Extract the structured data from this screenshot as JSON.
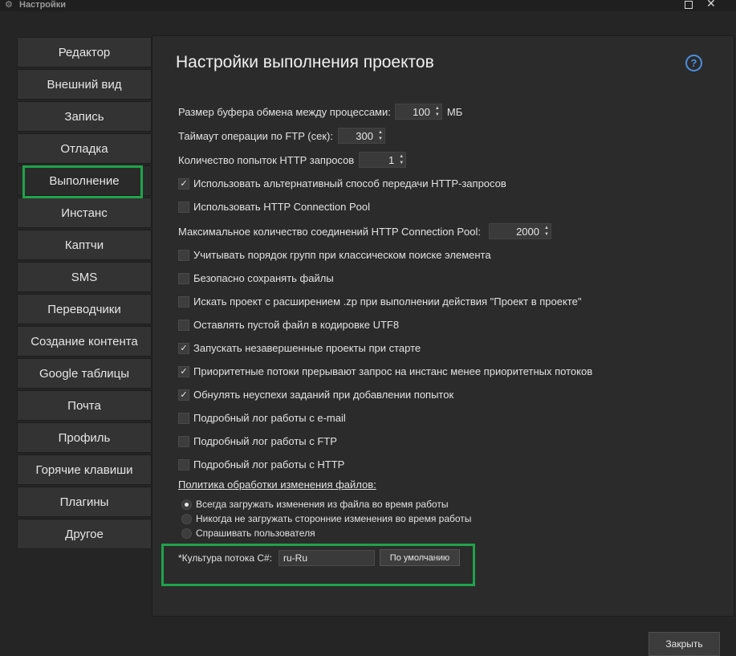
{
  "window": {
    "title": "Настройки",
    "icon": "gear-icon"
  },
  "sidebar": {
    "items": [
      {
        "label": "Редактор"
      },
      {
        "label": "Внешний вид"
      },
      {
        "label": "Запись"
      },
      {
        "label": "Отладка"
      },
      {
        "label": "Выполнение",
        "active": true
      },
      {
        "label": "Инстанс"
      },
      {
        "label": "Каптчи"
      },
      {
        "label": "SMS"
      },
      {
        "label": "Переводчики"
      },
      {
        "label": "Создание контента"
      },
      {
        "label": "Google таблицы"
      },
      {
        "label": "Почта"
      },
      {
        "label": "Профиль"
      },
      {
        "label": "Горячие клавиши"
      },
      {
        "label": "Плагины"
      },
      {
        "label": "Другое"
      }
    ]
  },
  "main": {
    "title": "Настройки выполнения проектов",
    "help_icon": "question-icon",
    "buffer": {
      "label": "Размер буфера обмена между процессами:",
      "value": "100",
      "unit": "МБ"
    },
    "ftp_timeout": {
      "label": "Таймаут операции по FTP (сек):",
      "value": "300"
    },
    "http_retries": {
      "label": "Количество попыток HTTP запросов",
      "value": "1"
    },
    "checkboxes_top": [
      {
        "label": "Использовать альтернативный способ передачи HTTP-запросов",
        "checked": true
      },
      {
        "label": "Использовать HTTP Connection Pool",
        "checked": false
      }
    ],
    "max_connections": {
      "label": "Максимальное количество соединений HTTP Connection Pool:",
      "value": "2000"
    },
    "checkboxes": [
      {
        "label": "Учитывать порядок групп при классическом поиске элемента",
        "checked": false
      },
      {
        "label": "Безопасно сохранять файлы",
        "checked": false
      },
      {
        "label": "Искать проект с расширением .zp при выполнении действия \"Проект в проекте\"",
        "checked": false
      },
      {
        "label": "Оставлять пустой файл в кодировке UTF8",
        "checked": false
      },
      {
        "label": "Запускать незавершенные проекты при старте",
        "checked": true
      },
      {
        "label": "Приоритетные потоки прерывают запрос на инстанс менее приоритетных потоков",
        "checked": true
      },
      {
        "label": "Обнулять неуспехи заданий при добавлении попыток",
        "checked": true
      },
      {
        "label": "Подробный лог работы с e-mail",
        "checked": false
      },
      {
        "label": "Подробный лог работы с FTP",
        "checked": false
      },
      {
        "label": "Подробный лог работы с HTTP",
        "checked": false
      }
    ],
    "file_policy": {
      "label": "Политика обработки изменения файлов:",
      "options": [
        {
          "label": "Всегда загружать изменения из файла во время работы",
          "selected": true
        },
        {
          "label": "Никогда не загружать сторонние изменения во время работы",
          "selected": false
        },
        {
          "label": "Спрашивать пользователя",
          "selected": false
        }
      ]
    },
    "culture": {
      "label": "*Культура потока C#:",
      "value": "ru-Ru",
      "default_button": "По умолчанию"
    }
  },
  "footer": {
    "close_label": "Закрыть"
  },
  "colors": {
    "highlight": "#1fa34a",
    "accent": "#4a90e2",
    "background": "#252525"
  }
}
